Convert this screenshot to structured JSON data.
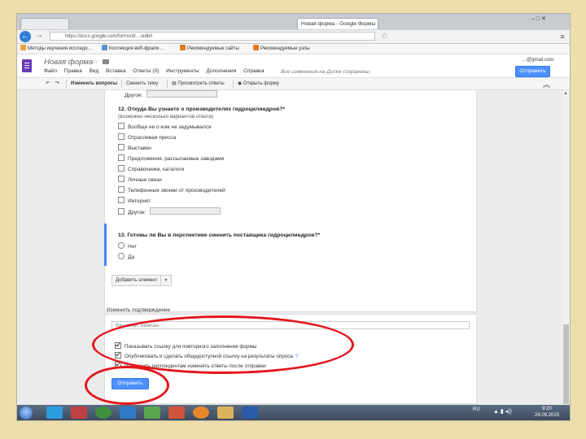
{
  "browser": {
    "tabs": [
      {
        "label": ""
      },
      {
        "label": "Новая форма - Google Формы"
      }
    ],
    "address": "https://docs.google.com/forms/d/…/edit#",
    "bookmarks": [
      "Методы изучения исследо…",
      "Коллекция веб-фрагм…",
      "Рекомендуемые сайты",
      "Рекомендуемые узлы"
    ],
    "window_controls": "–  □  ✕"
  },
  "app": {
    "title": "Новая форма",
    "menu": [
      "Файл",
      "Правка",
      "Вид",
      "Вставка",
      "Ответы (0)",
      "Инструменты",
      "Дополнения",
      "Справка"
    ],
    "save_status": "Все изменения на Диске сохранены",
    "account": "…@gmail.com",
    "send_label": "Отправить"
  },
  "toolbar": {
    "items": [
      "Изменить вопросы",
      "Сменить тему",
      "Просмотреть ответы",
      "Открыть форму"
    ]
  },
  "form": {
    "prev_other_label": "Другое:",
    "q12": {
      "title": "12. Откуда Вы узнаете о производителях гидроцилиндров?*",
      "hint": "(возможно несколько вариантов ответа)",
      "options": [
        "Вообще ни о ком не задумывался",
        "Отраслевая пресса",
        "Выставки",
        "Предложения, рассылаемые заводами",
        "Справочники, каталоги",
        "Личные связи",
        "Телефонные звонки от производителей",
        "Интернет",
        "Другое:"
      ]
    },
    "q13": {
      "title": "13. Готовы ли Вы в перспективе сменить поставщика гидроцилиндров?*",
      "options": [
        "Нет",
        "Да"
      ]
    },
    "add_item_label": "Добавить элемент"
  },
  "confirmation": {
    "label": "Изменить подтверждение",
    "placeholder": "Ваш ответ записан.",
    "settings": [
      "Показывать ссылку для повторного заполнения формы",
      "Опубликовать и сделать общедоступной ссылку на результаты опроса",
      "Разрешить респондентам изменять ответы после отправки"
    ],
    "submit_label": "Отправить"
  },
  "taskbar": {
    "tray_lang": "RU",
    "time": "9:20",
    "date": "24.09.2015"
  },
  "annotation_color": "#e3161c",
  "accent_color": "#4d90fe"
}
